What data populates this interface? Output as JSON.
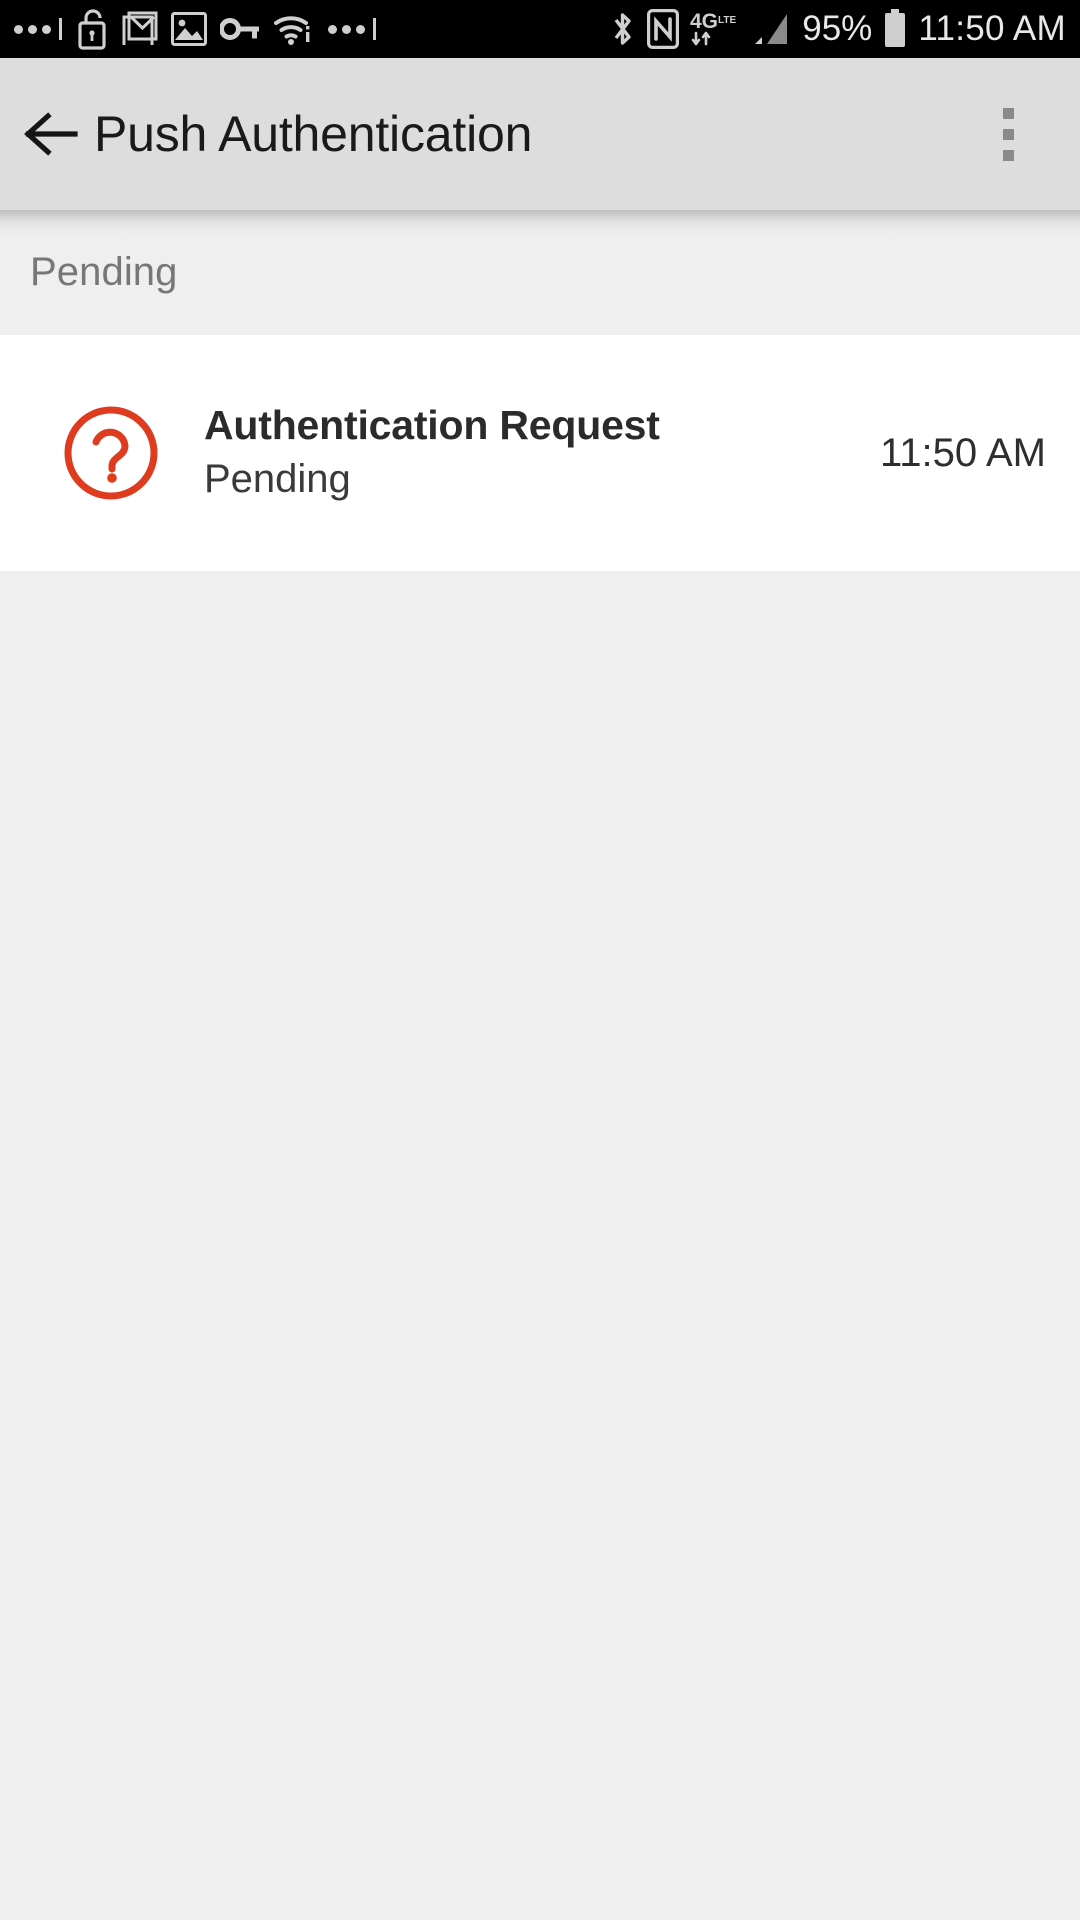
{
  "status_bar": {
    "background_color": "#000000",
    "icon_color": "#cfcfcf",
    "left_icons": [
      "more-dots-icon",
      "unlock-shield-icon",
      "gmail-icon",
      "photo-icon",
      "vpn-key-icon",
      "wifi-icon",
      "more-dots-icon"
    ],
    "right_icons": [
      "bluetooth-icon",
      "nfc-icon",
      "4g-lte-data-icon",
      "cell-signal-icon"
    ],
    "battery_percent": "95%",
    "time": "11:50 AM"
  },
  "app_bar": {
    "background_color": "#dddddd",
    "back_label": "back-arrow",
    "title": "Push Authentication",
    "overflow_label": "More options"
  },
  "section": {
    "header": "Pending"
  },
  "list": {
    "rows": [
      {
        "icon": "question-circle-icon",
        "icon_color": "#de3b1f",
        "title": "Authentication Request",
        "subtitle": "Pending",
        "time": "11:50 AM"
      }
    ]
  },
  "colors": {
    "page_background": "#efefef",
    "card_background": "#ffffff",
    "accent": "#de3b1f",
    "section_text": "#777777"
  }
}
